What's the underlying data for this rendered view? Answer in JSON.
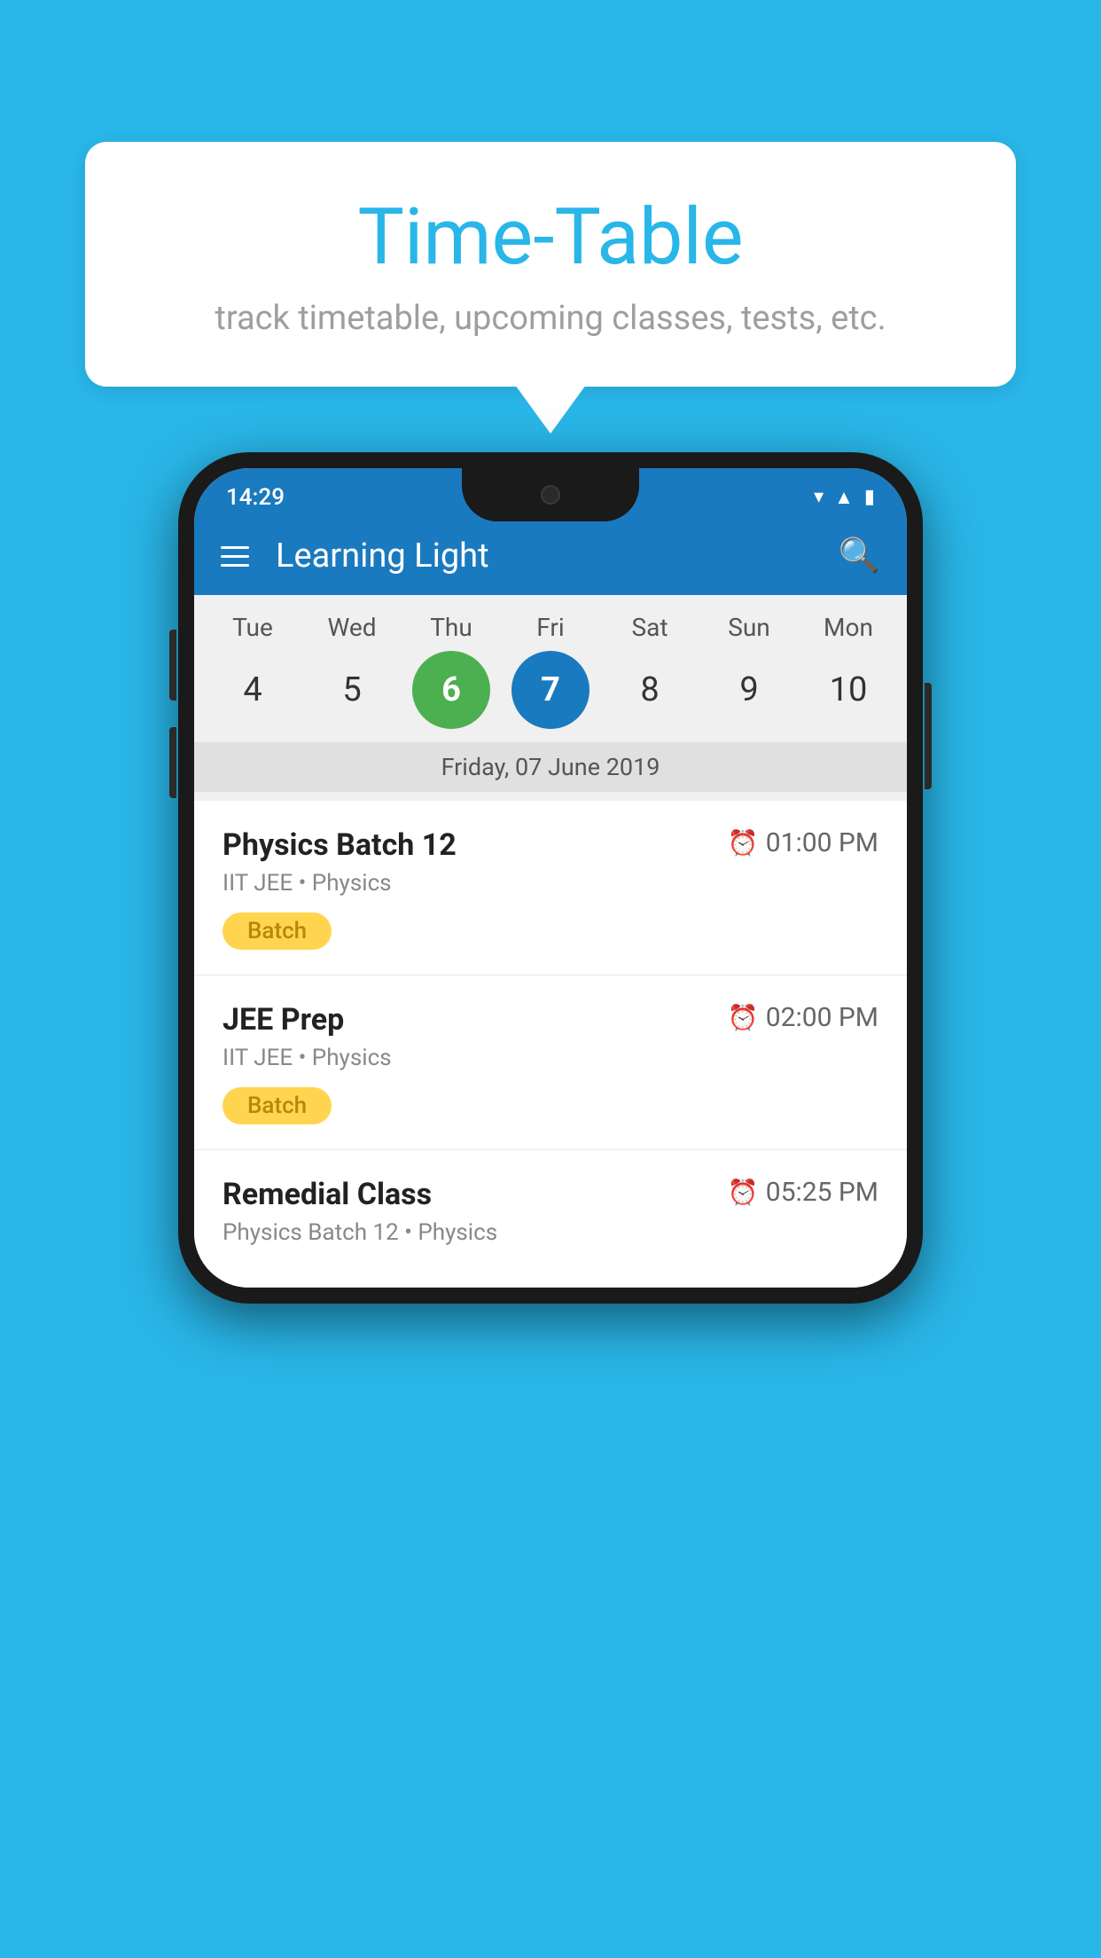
{
  "background_color": "#29b6e8",
  "card": {
    "title": "Time-Table",
    "subtitle": "track timetable, upcoming classes, tests, etc."
  },
  "status_bar": {
    "time": "14:29"
  },
  "app_bar": {
    "title": "Learning Light"
  },
  "calendar": {
    "days": [
      "Tue",
      "Wed",
      "Thu",
      "Fri",
      "Sat",
      "Sun",
      "Mon"
    ],
    "dates": [
      4,
      5,
      6,
      7,
      8,
      9,
      10
    ],
    "today_index": 2,
    "selected_index": 3,
    "selected_label": "Friday, 07 June 2019"
  },
  "schedule": [
    {
      "name": "Physics Batch 12",
      "time": "01:00 PM",
      "sub": "IIT JEE • Physics",
      "tag": "Batch"
    },
    {
      "name": "JEE Prep",
      "time": "02:00 PM",
      "sub": "IIT JEE • Physics",
      "tag": "Batch"
    },
    {
      "name": "Remedial Class",
      "time": "05:25 PM",
      "sub": "Physics Batch 12 • Physics",
      "tag": ""
    }
  ]
}
